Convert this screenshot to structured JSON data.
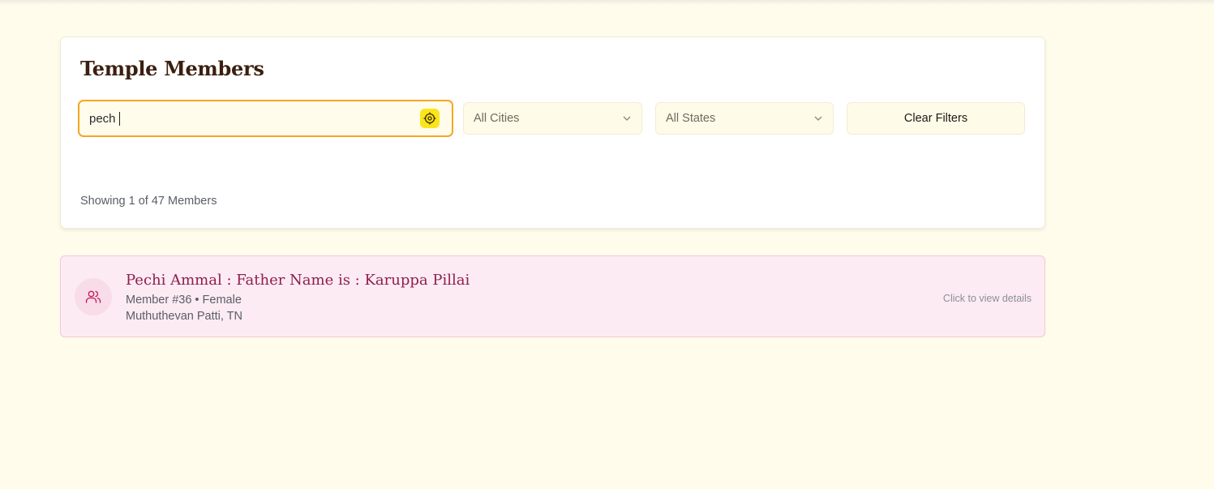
{
  "panel": {
    "title": "Temple Members",
    "search": {
      "value": "pech",
      "button_icon": "target-icon"
    },
    "city_filter": {
      "selected": "All Cities",
      "icon": "chevron-down-icon"
    },
    "state_filter": {
      "selected": "All States",
      "icon": "chevron-down-icon"
    },
    "clear_label": "Clear Filters",
    "showing_text": "Showing 1 of 47 Members"
  },
  "members": [
    {
      "name": "Pechi Ammal : Father Name is : Karuppa Pillai",
      "meta": "Member #36 • Female",
      "place": "Muthuthevan Patti, TN",
      "hint": "Click to view details",
      "icon": "users-icon"
    }
  ],
  "colors": {
    "background": "#fffcec",
    "accent_border": "#f5a623",
    "target_button": "#fbe41a",
    "title": "#3b1f10",
    "member_card_bg": "#fcebf3",
    "member_name": "#8e1f4c"
  }
}
